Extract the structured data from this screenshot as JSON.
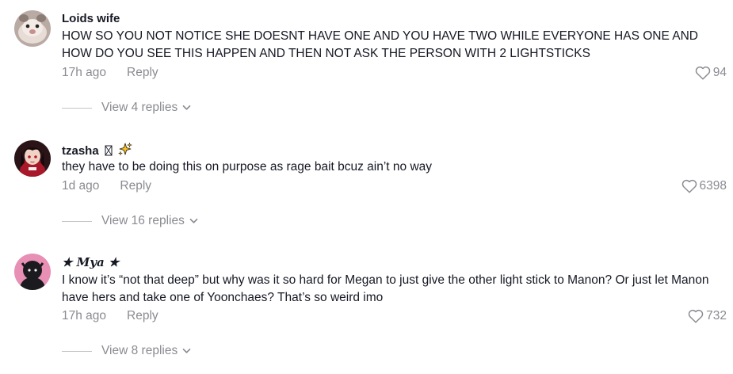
{
  "comments": [
    {
      "username": "Loids wife",
      "text": "HOW SO YOU NOT NOTICE SHE DOESNT HAVE ONE AND YOU HAVE TWO WHILE EVERYONE HAS ONE AND HOW DO YOU SEE THIS HAPPEN AND THEN NOT ASK THE PERSON WITH 2 LIGHTSTICKS",
      "time": "17h ago",
      "reply_label": "Reply",
      "likes": "94",
      "view_replies": "View 4 replies",
      "avatar": "pet-photo-avatar"
    },
    {
      "username": "tzasha",
      "username_emoji": "sparkles-icon",
      "text": "they have to be doing this on purpose as rage bait bcuz ain’t no way",
      "time": "1d ago",
      "reply_label": "Reply",
      "likes": "6398",
      "view_replies": "View 16 replies",
      "avatar": "anime-avatar"
    },
    {
      "username": "★ 𝑴𝒚𝒂 ★",
      "text": "I know it’s “not that deep” but why was it so hard for Megan to just give the other light stick to Manon? Or just let Manon have hers and take one of Yoonchaes? That’s so weird imo",
      "time": "17h ago",
      "reply_label": "Reply",
      "likes": "732",
      "view_replies": "View 8 replies",
      "avatar": "dark-figure-avatar"
    }
  ],
  "colors": {
    "text": "#161823",
    "muted": "#8a8b91",
    "divider": "#c5c5c8"
  }
}
